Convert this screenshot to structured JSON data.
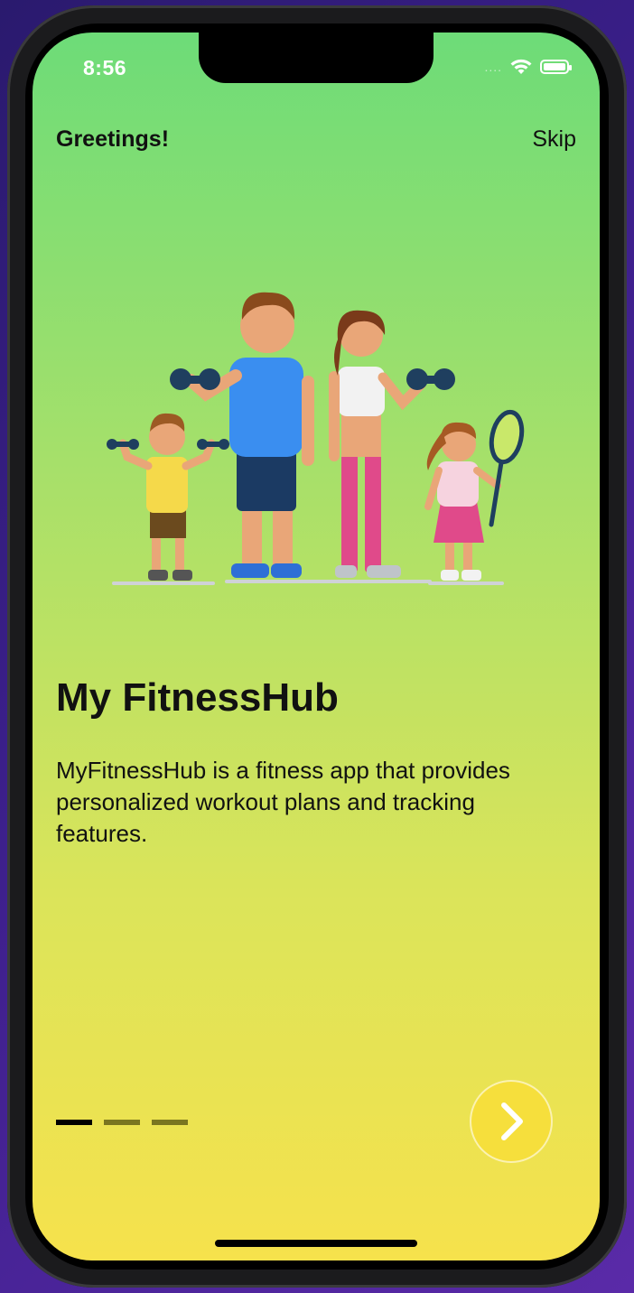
{
  "status_bar": {
    "time": "8:56",
    "signal": "....",
    "wifi_icon": "wifi-icon",
    "battery_icon": "battery-icon"
  },
  "header": {
    "greeting": "Greetings!",
    "skip_label": "Skip"
  },
  "illustration": {
    "icon": "family-fitness-illustration"
  },
  "content": {
    "title": "My FitnessHub",
    "description": "MyFitnessHub is a fitness app that provides personalized workout plans and tracking features."
  },
  "pager": {
    "pages": 3,
    "current": 1
  },
  "next_button": {
    "icon": "chevron-right-icon"
  },
  "colors": {
    "gradient_top": "#6ddc78",
    "gradient_bottom": "#f6e24c",
    "button": "#f6df3c"
  }
}
